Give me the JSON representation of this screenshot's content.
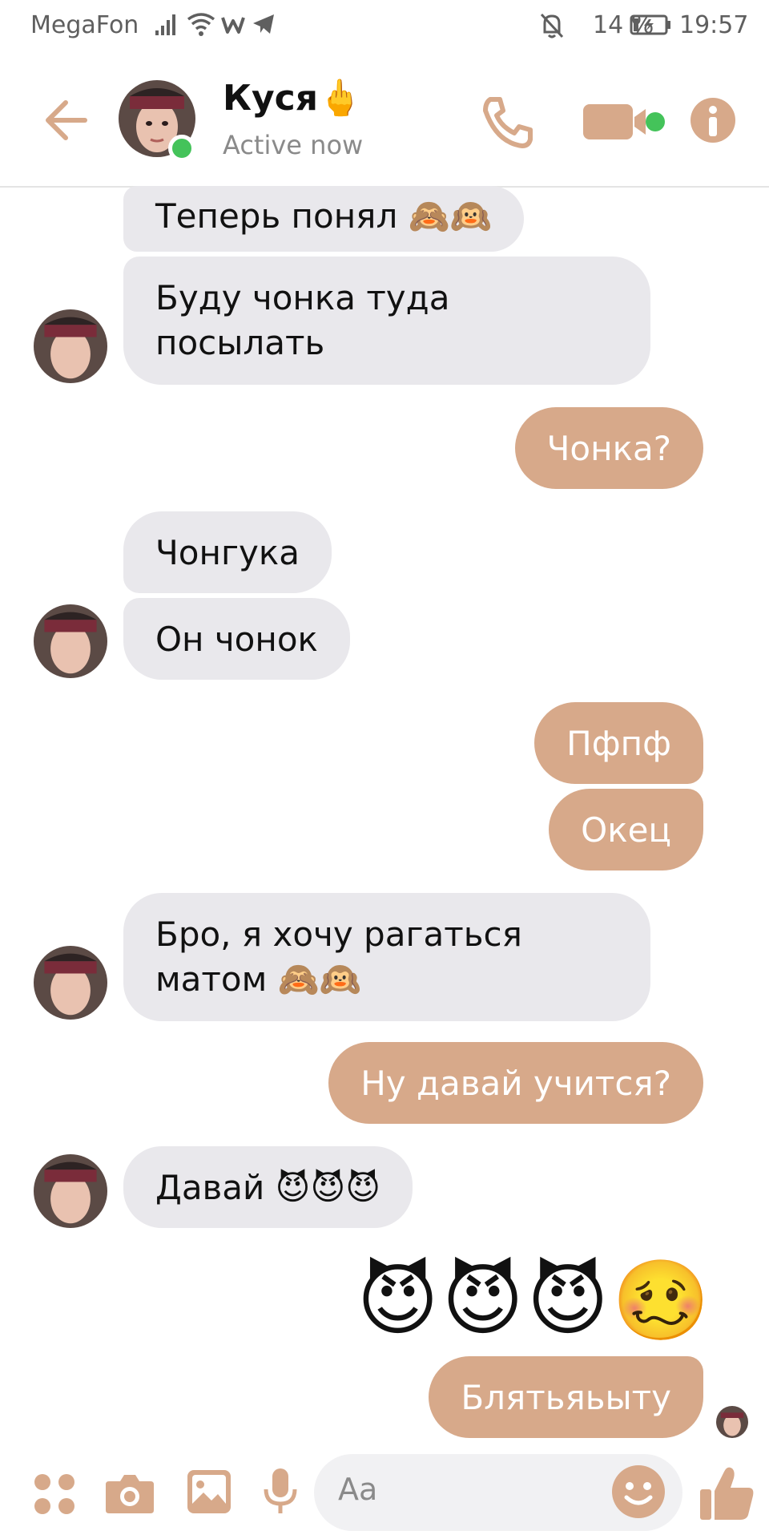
{
  "status_bar": {
    "carrier": "MegaFon",
    "battery": "14 %",
    "time": "19:57",
    "icons": [
      "signal-icon",
      "wifi-icon",
      "w-app-icon",
      "telegram-icon",
      "mute-bell-icon",
      "battery-icon"
    ]
  },
  "header": {
    "contact_name": "Куся",
    "name_emoji": "🖕",
    "status": "Active now",
    "icons": [
      "back-arrow-icon",
      "call-icon",
      "video-call-icon",
      "info-icon"
    ],
    "accent_color": "#d7a98a",
    "online_color": "#44c35a"
  },
  "messages": [
    {
      "side": "in",
      "text": "Теперь понял 🙈🙉"
    },
    {
      "side": "in",
      "text": "Буду чонка туда\nпосылать"
    },
    {
      "side": "out",
      "text": "Чонка?"
    },
    {
      "side": "in",
      "text": "Чонгука"
    },
    {
      "side": "in",
      "text": "Он чонок"
    },
    {
      "side": "out",
      "text": "Пфпф"
    },
    {
      "side": "out",
      "text": "Окец"
    },
    {
      "side": "in",
      "text": "Бро, я хочу рагаться\nматом 🙈🙉"
    },
    {
      "side": "out",
      "text": "Ну давай учится?"
    },
    {
      "side": "in",
      "text": "Давай 😈😈😈"
    },
    {
      "side": "out",
      "text": "😈😈😈🥴"
    },
    {
      "side": "out",
      "text": "Блятьяьыту"
    }
  ],
  "composer": {
    "placeholder": "Aa",
    "icons": [
      "apps-icon",
      "camera-icon",
      "gallery-icon",
      "mic-icon",
      "emoji-icon",
      "thumbs-up-icon"
    ]
  },
  "colors": {
    "incoming_bubble": "#e9e8ec",
    "outgoing_bubble": "#d7a98a"
  }
}
